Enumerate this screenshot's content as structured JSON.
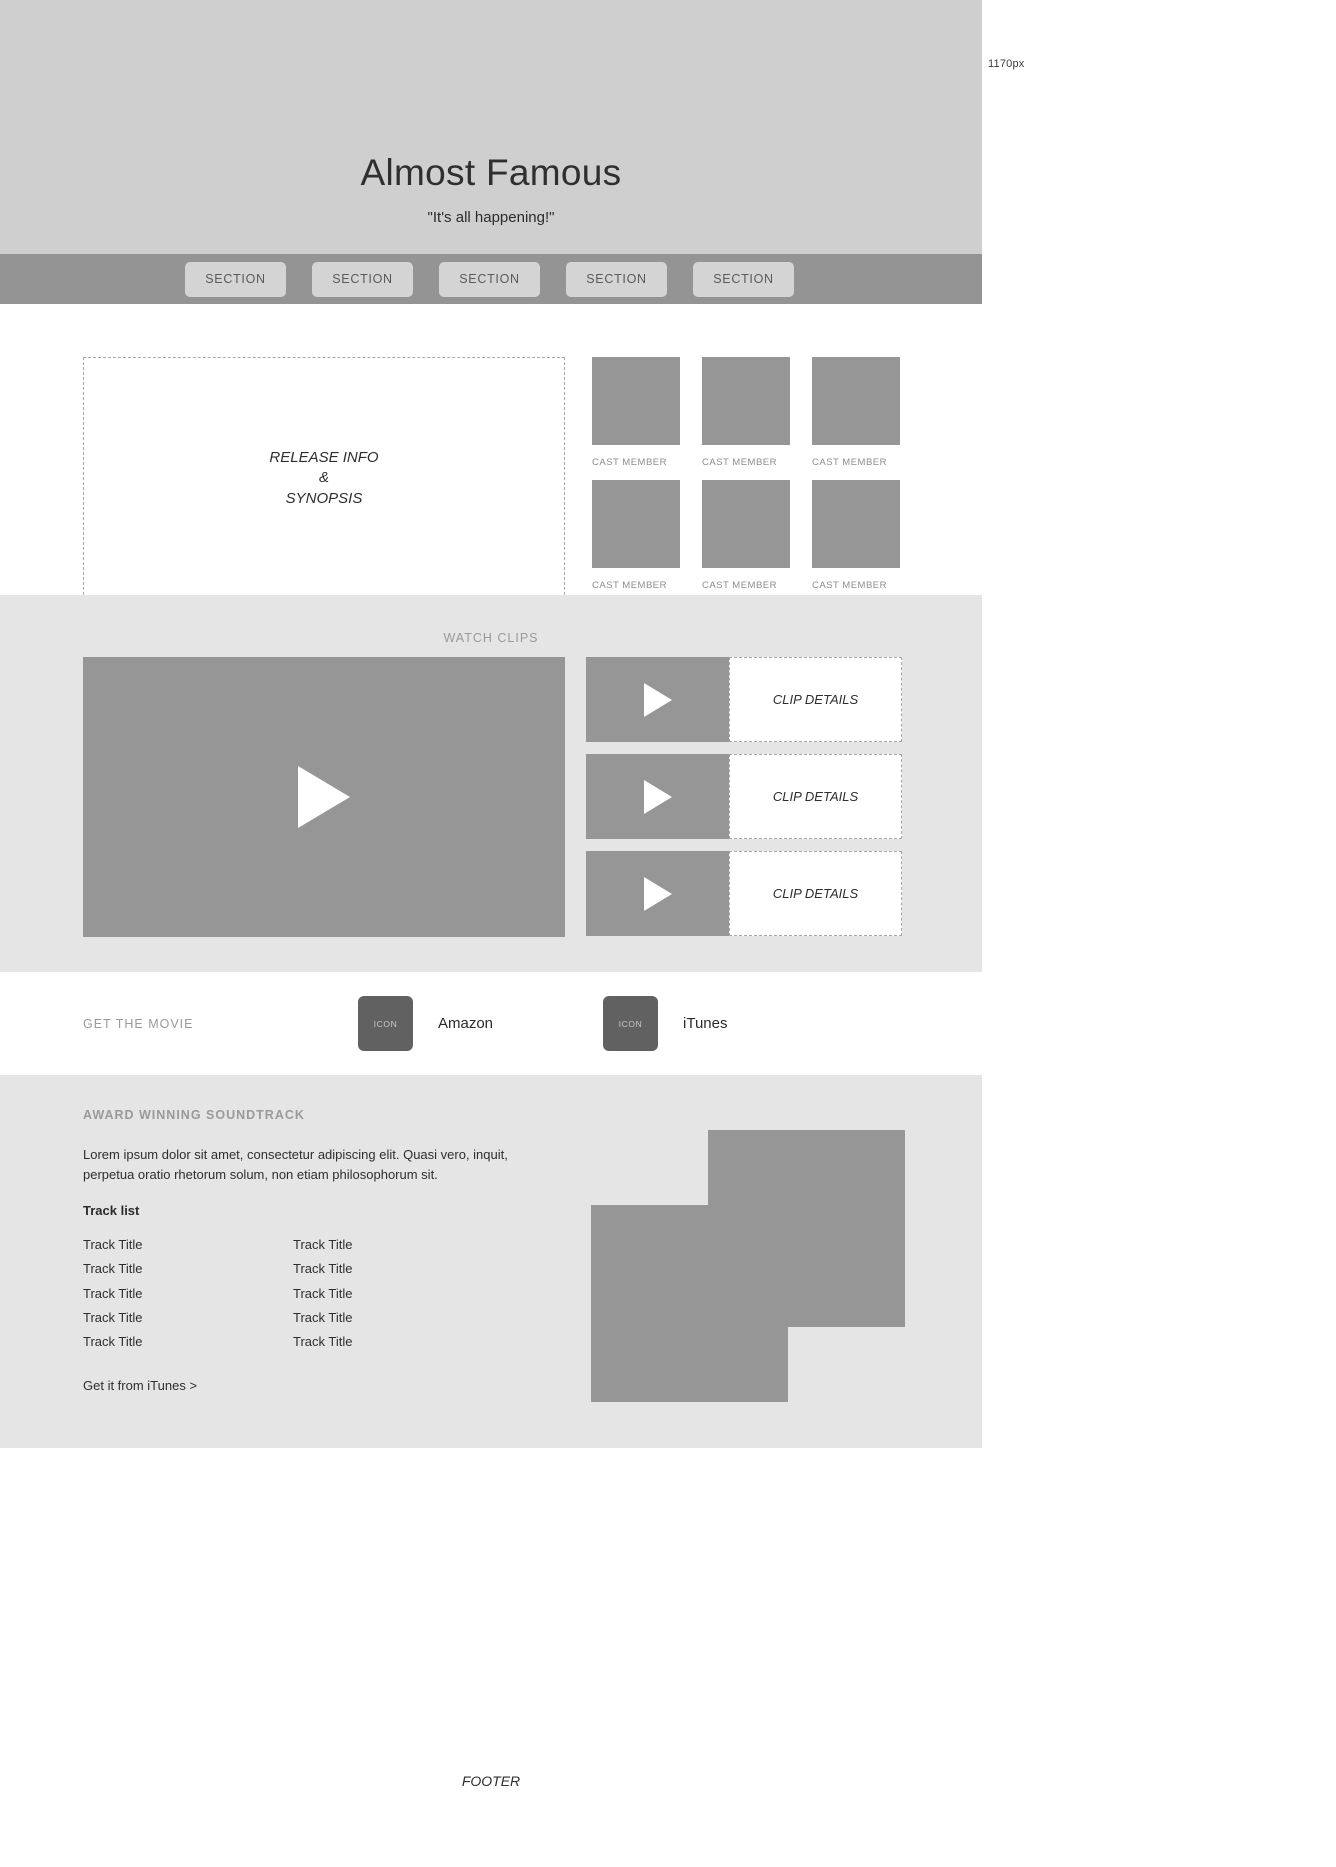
{
  "canvas": {
    "width_label": "1170px"
  },
  "hero": {
    "title": "Almost Famous",
    "tagline": "\"It's all happening!\""
  },
  "nav": {
    "items": [
      {
        "label": "SECTION"
      },
      {
        "label": "SECTION"
      },
      {
        "label": "SECTION"
      },
      {
        "label": "SECTION"
      },
      {
        "label": "SECTION"
      }
    ]
  },
  "info": {
    "release_box": {
      "line1": "RELEASE INFO",
      "line2": "&",
      "line3": "SYNOPSIS"
    },
    "cast": [
      {
        "label": "CAST MEMBER"
      },
      {
        "label": "CAST MEMBER"
      },
      {
        "label": "CAST MEMBER"
      },
      {
        "label": "CAST MEMBER"
      },
      {
        "label": "CAST MEMBER"
      },
      {
        "label": "CAST MEMBER"
      }
    ]
  },
  "clips": {
    "heading": "WATCH CLIPS",
    "items": [
      {
        "details": "CLIP DETAILS"
      },
      {
        "details": "CLIP DETAILS"
      },
      {
        "details": "CLIP DETAILS"
      }
    ]
  },
  "get_movie": {
    "heading": "GET THE MOVIE",
    "stores": [
      {
        "icon_label": "ICON",
        "name": "Amazon"
      },
      {
        "icon_label": "ICON",
        "name": "iTunes"
      }
    ]
  },
  "soundtrack": {
    "heading": "AWARD WINNING SOUNDTRACK",
    "copy": "Lorem ipsum dolor sit amet, consectetur adipiscing elit. Quasi vero, inquit, perpetua oratio rhetorum solum, non etiam philosophorum sit.",
    "tracklist_title": "Track list",
    "tracks": [
      "Track Title",
      "Track Title",
      "Track Title",
      "Track Title",
      "Track Title",
      "Track Title",
      "Track Title",
      "Track Title",
      "Track Title",
      "Track Title"
    ],
    "itunes_link": "Get it from iTunes >"
  },
  "footer": {
    "label": "FOOTER"
  },
  "colors": {
    "hero_bg": "#cfcfcf",
    "nav_bg": "#949494",
    "placeholder": "#969696",
    "band_bg": "#e5e5e5",
    "icon_bg": "#616161",
    "muted_text": "#9a9a9a"
  }
}
